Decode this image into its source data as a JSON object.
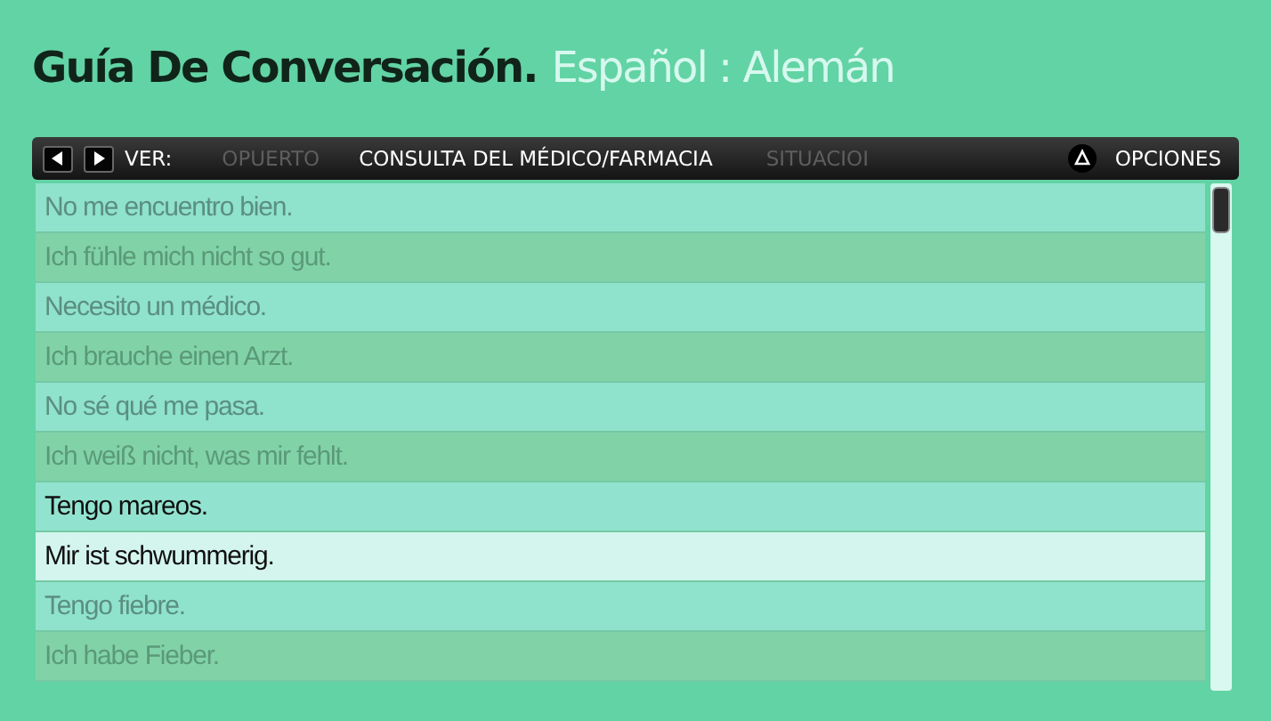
{
  "title": {
    "main": "Guía De Conversación.",
    "languages": "Español : Alemán"
  },
  "toolbar": {
    "label": "VER:",
    "tabs": [
      {
        "label": "OPUERTO",
        "selected": false
      },
      {
        "label": "CONSULTA DEL MÉDICO/FARMACIA",
        "selected": true
      },
      {
        "label": "SITUACIOI",
        "selected": false
      }
    ],
    "options": "OPCIONES"
  },
  "phrases": [
    {
      "kind": "spanish",
      "text": "No me encuentro bien.",
      "selected": false
    },
    {
      "kind": "german",
      "text": "Ich fühle mich nicht so gut.",
      "selected": false
    },
    {
      "kind": "spanish",
      "text": "Necesito un médico.",
      "selected": false
    },
    {
      "kind": "german",
      "text": "Ich brauche einen Arzt.",
      "selected": false
    },
    {
      "kind": "spanish",
      "text": "No sé qué me pasa.",
      "selected": false
    },
    {
      "kind": "german",
      "text": "Ich weiß nicht, was mir fehlt.",
      "selected": false
    },
    {
      "kind": "spanish",
      "text": "Tengo mareos.",
      "selected": true
    },
    {
      "kind": "german",
      "text": "Mir ist schwummerig.",
      "selected": true
    },
    {
      "kind": "spanish",
      "text": "Tengo fiebre.",
      "selected": false
    },
    {
      "kind": "german",
      "text": "Ich habe Fieber.",
      "selected": false
    }
  ]
}
